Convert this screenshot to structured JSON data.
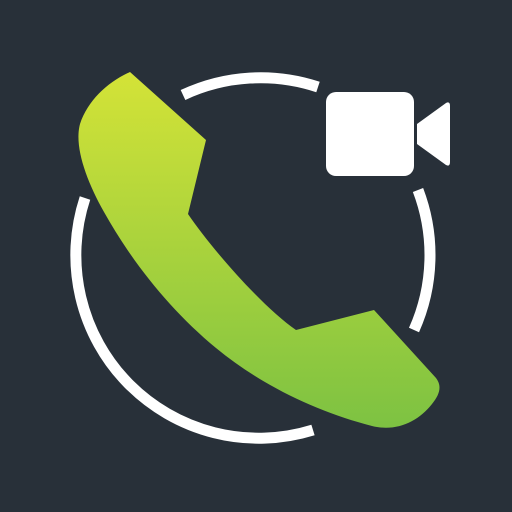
{
  "icon": {
    "name": "video-call-app-icon",
    "background_color": "#283039",
    "ring_color": "#ffffff",
    "camera_color": "#ffffff",
    "phone_gradient_top": "#d4e337",
    "phone_gradient_bottom": "#7dc242",
    "glyphs": [
      "phone-handset-icon",
      "video-camera-icon",
      "ring"
    ]
  }
}
